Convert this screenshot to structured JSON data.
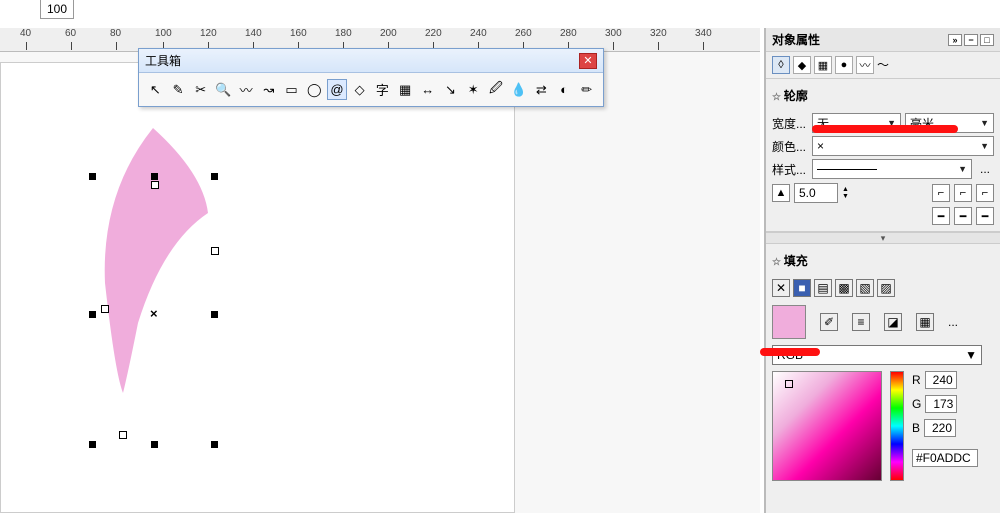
{
  "topfrag": {
    "zoom": "100"
  },
  "ruler": {
    "start": 40,
    "step": 20,
    "count": 16
  },
  "toolbox": {
    "title": "工具箱",
    "tools": [
      "pointer",
      "shape-tool",
      "crop",
      "zoom",
      "freehand",
      "bezier",
      "rectangle",
      "ellipse",
      "spiral",
      "polygon",
      "text",
      "table",
      "dimension",
      "connector",
      "effects",
      "eyedrop-fill",
      "eyedropper",
      "blend",
      "fill",
      "outline"
    ],
    "selected_index": 8,
    "glyphs": [
      "↖",
      "✎",
      "✂",
      "🔍",
      "〰",
      "↝",
      "▭",
      "◯",
      "@",
      "◇",
      "字",
      "▦",
      "↔",
      "↘",
      "✶",
      "🖉",
      "💧",
      "⇄",
      "◐",
      "✏"
    ]
  },
  "panel": {
    "title": "对象属性",
    "tabs": [
      "outline-tab",
      "fill-tab",
      "fx-tab",
      "web-tab",
      "wave-tab"
    ],
    "tab_glyphs": [
      "◊",
      "◆",
      "▦",
      "●",
      "〰"
    ],
    "outline": {
      "header": "轮廓",
      "width_label": "宽度...",
      "width_value": "无",
      "unit_value": "毫米",
      "color_label": "颜色...",
      "color_value": "×",
      "style_label": "样式...",
      "style_more": "...",
      "miter_value": "5.0"
    },
    "fill": {
      "header": "填充",
      "type_icons": [
        "none",
        "solid",
        "fountain",
        "pattern",
        "texture",
        "postscript"
      ],
      "type_glyphs": [
        "✕",
        "■",
        "▤",
        "▩",
        "▧",
        "▨"
      ],
      "eyedrop": "eyedropper-icon",
      "adjust": "adjust-icon",
      "edit": "edit-fill-icon",
      "attrs": "attrs-icon",
      "more": "...",
      "mode": "RGB",
      "r_label": "R",
      "r": "240",
      "g_label": "G",
      "g": "173",
      "b_label": "B",
      "b": "220",
      "hex": "#F0ADDC"
    }
  }
}
